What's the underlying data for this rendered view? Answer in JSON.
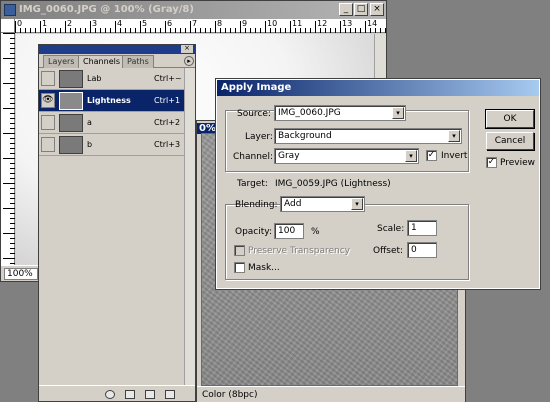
{
  "doc_window": {
    "title": "IMG_0060.JPG @ 100% (Gray/8)",
    "minimize": "_",
    "maximize": "□",
    "close": "×",
    "ruler_labels": [
      "0",
      "1",
      "2",
      "3",
      "4",
      "5",
      "6",
      "7",
      "8",
      "9",
      "10",
      "11",
      "12",
      "13",
      "14"
    ],
    "zoom": "100%"
  },
  "doc2": {
    "title_fragment": "0%",
    "status_mode": "Color (8bpc)"
  },
  "channels_palette": {
    "tabs": [
      "Layers",
      "Channels",
      "Paths"
    ],
    "active_tab": "Channels",
    "menu_glyph": "▸",
    "close_glyph": "×",
    "eye_glyph": "👁",
    "channels": [
      {
        "name": "Lab",
        "shortcut": "Ctrl+~",
        "visible": false,
        "selected": false
      },
      {
        "name": "Lightness",
        "shortcut": "Ctrl+1",
        "visible": true,
        "selected": true
      },
      {
        "name": "a",
        "shortcut": "Ctrl+2",
        "visible": false,
        "selected": false
      },
      {
        "name": "b",
        "shortcut": "Ctrl+3",
        "visible": false,
        "selected": false
      }
    ]
  },
  "apply_image": {
    "title": "Apply Image",
    "source_group": "Source:",
    "source_value": "IMG_0060.JPG",
    "layer_label": "Layer:",
    "layer_value": "Background",
    "channel_label": "Channel:",
    "channel_value": "Gray",
    "invert_label": "Invert",
    "invert_checked": true,
    "target_label": "Target:",
    "target_value": "IMG_0059.JPG (Lightness)",
    "blending_label": "Blending:",
    "blending_value": "Add",
    "opacity_label": "Opacity:",
    "opacity_value": "100",
    "opacity_unit": "%",
    "preserve_transparency_label": "Preserve Transparency",
    "mask_label": "Mask...",
    "scale_label": "Scale:",
    "scale_value": "1",
    "offset_label": "Offset:",
    "offset_value": "0",
    "ok_label": "OK",
    "cancel_label": "Cancel",
    "preview_label": "Preview",
    "preview_checked": true,
    "check_glyph": "✓",
    "dropdown_glyph": "▾"
  }
}
